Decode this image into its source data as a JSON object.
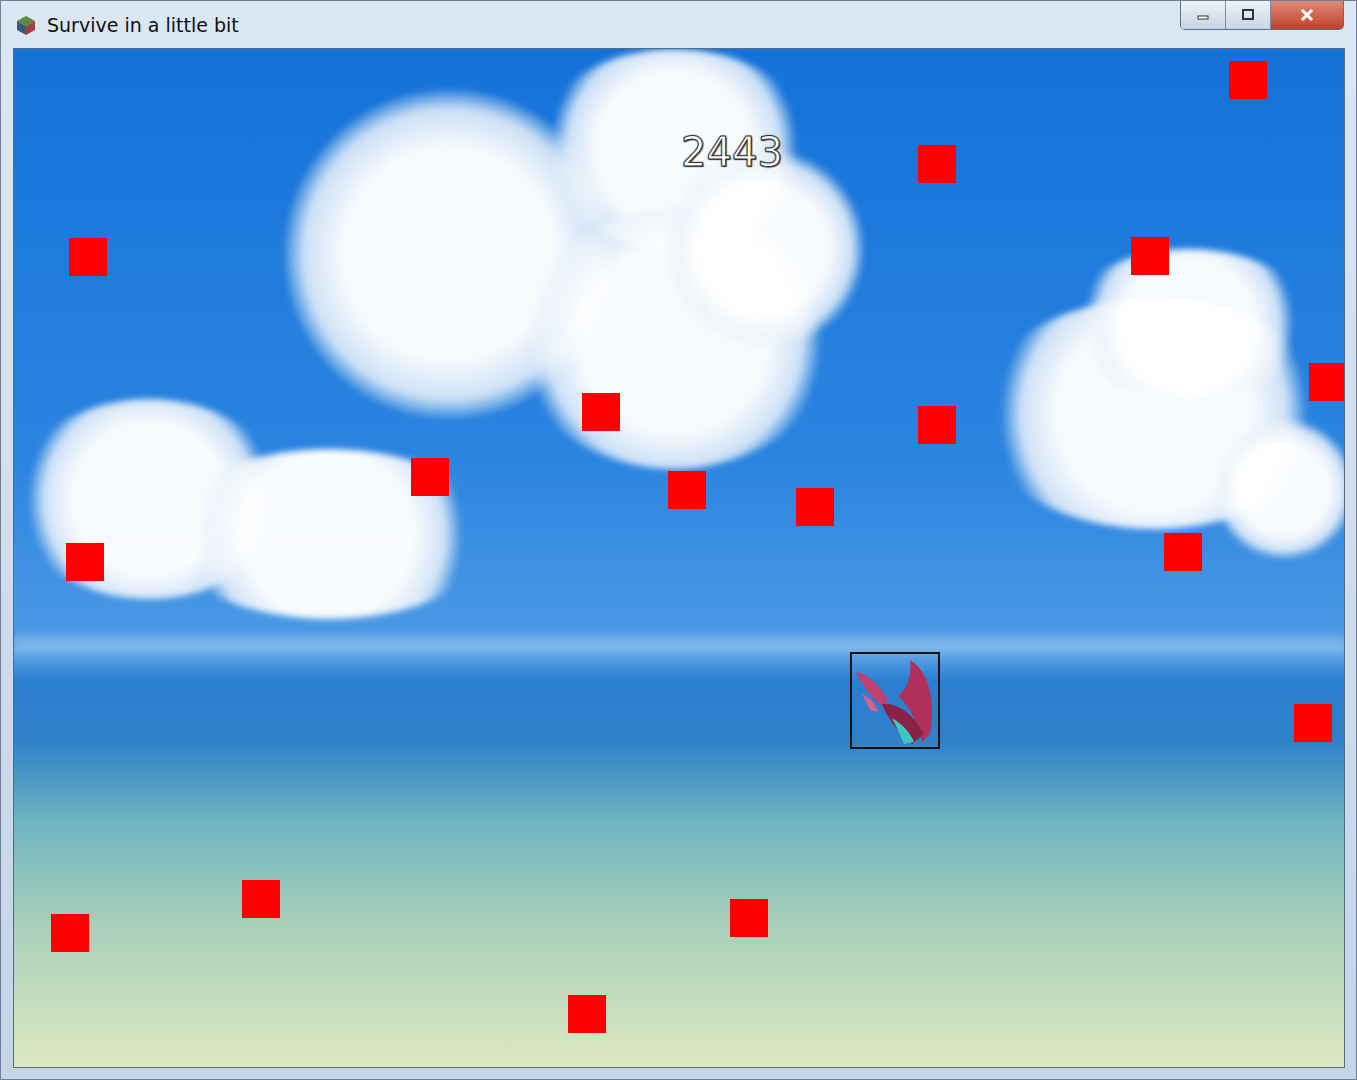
{
  "window": {
    "title": "Survive in a little bit"
  },
  "hud": {
    "score": "2443"
  }
}
